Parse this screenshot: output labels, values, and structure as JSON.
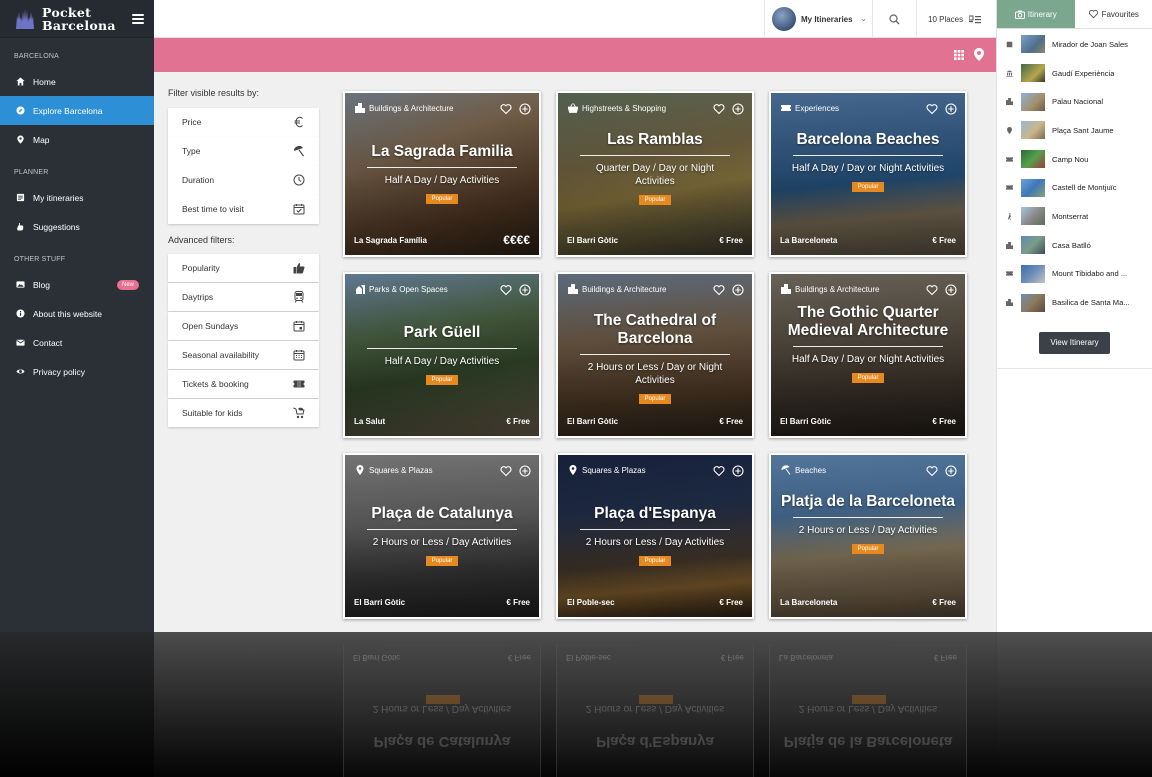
{
  "brand": {
    "line1": "Pocket",
    "line2": "Barcelona"
  },
  "sidebar": {
    "section_city": "BARCELONA",
    "section_planner": "PLANNER",
    "section_other": "OTHER STUFF",
    "items": [
      {
        "label": "Home",
        "icon": "home-icon"
      },
      {
        "label": "Explore Barcelona",
        "icon": "compass-icon",
        "active": true
      },
      {
        "label": "Map",
        "icon": "map-pin-icon"
      },
      {
        "label": "My itineraries",
        "icon": "list-icon"
      },
      {
        "label": "Suggestions",
        "icon": "hand-icon"
      },
      {
        "label": "Blog",
        "icon": "image-icon",
        "badge": "New"
      },
      {
        "label": "About this website",
        "icon": "info-icon"
      },
      {
        "label": "Contact",
        "icon": "mail-icon"
      },
      {
        "label": "Privacy policy",
        "icon": "eye-icon"
      }
    ]
  },
  "topbar": {
    "itineraries_label": "My Itineraries",
    "places_label": "10 Places"
  },
  "panel": {
    "tabs": [
      "Itinerary",
      "Favourites"
    ],
    "places": [
      {
        "name": "Mirador de Joan Sales",
        "icon": "building-icon"
      },
      {
        "name": "Gaudí Experiència",
        "icon": "museum-icon"
      },
      {
        "name": "Palau Nacional",
        "icon": "city-icon"
      },
      {
        "name": "Plaça Sant Jaume",
        "icon": "pin-icon"
      },
      {
        "name": "Camp Nou",
        "icon": "ticket-icon"
      },
      {
        "name": "Castell de Montjuïc",
        "icon": "ticket-icon"
      },
      {
        "name": "Montserrat",
        "icon": "hiker-icon"
      },
      {
        "name": "Casa Batlló",
        "icon": "city-icon"
      },
      {
        "name": "Mount Tibidabo and ...",
        "icon": "ticket-icon"
      },
      {
        "name": "Basilica de Santa Ma...",
        "icon": "city-icon"
      }
    ],
    "view_button": "View Itinerary"
  },
  "filters": {
    "title": "Filter visible results by:",
    "items": [
      "Price",
      "Type",
      "Duration",
      "Best time to visit"
    ],
    "advanced_title": "Advanced filters:",
    "advanced": [
      "Popularity",
      "Daytrips",
      "Open Sundays",
      "Seasonal availability",
      "Tickets & booking",
      "Suitable for kids"
    ]
  },
  "cards": [
    {
      "category": "Buildings & Architecture",
      "title": "La Sagrada Familia",
      "duration": "Half A Day / Day Activities",
      "popular": "Popular",
      "neighbourhood": "La Sagrada Família",
      "price": "€€€€"
    },
    {
      "category": "Highstreets & Shopping",
      "title": "Las Ramblas",
      "duration": "Quarter Day / Day or Night Activities",
      "popular": "Popular",
      "neighbourhood": "El Barri Gòtic",
      "price": "€ Free"
    },
    {
      "category": "Experiences",
      "title": "Barcelona Beaches",
      "duration": "Half A Day / Day or Night Activities",
      "popular": "Popular",
      "neighbourhood": "La Barceloneta",
      "price": "€ Free"
    },
    {
      "category": "Parks & Open Spaces",
      "title": "Park Güell",
      "duration": "Half A Day / Day Activities",
      "popular": "Popular",
      "neighbourhood": "La Salut",
      "price": "€ Free"
    },
    {
      "category": "Buildings & Architecture",
      "title": "The Cathedral of Barcelona",
      "duration": "2 Hours or Less / Day or Night Activities",
      "popular": "Popular",
      "neighbourhood": "El Barri Gòtic",
      "price": "€ Free"
    },
    {
      "category": "Buildings & Architecture",
      "title": "The Gothic Quarter Medieval Architecture",
      "duration": "Half A Day / Day or Night Activities",
      "popular": "Popular",
      "neighbourhood": "El Barri Gòtic",
      "price": "€ Free"
    },
    {
      "category": "Squares & Plazas",
      "title": "Plaça de Catalunya",
      "duration": "2 Hours or Less / Day Activities",
      "popular": "Popular",
      "neighbourhood": "El Barri Gòtic",
      "price": "€ Free"
    },
    {
      "category": "Squares & Plazas",
      "title": "Plaça d'Espanya",
      "duration": "2 Hours or Less / Day Activities",
      "popular": "Popular",
      "neighbourhood": "El Poble-sec",
      "price": "€ Free"
    },
    {
      "category": "Beaches",
      "title": "Platja de la Barceloneta",
      "duration": "2 Hours or Less / Day Activities",
      "popular": "Popular",
      "neighbourhood": "La Barceloneta",
      "price": "€ Free"
    }
  ],
  "colors": {
    "accent": "#e17291",
    "active_nav": "#2d8fd5",
    "itinerary_tab": "#7aa78e",
    "popular": "#e6891f"
  }
}
